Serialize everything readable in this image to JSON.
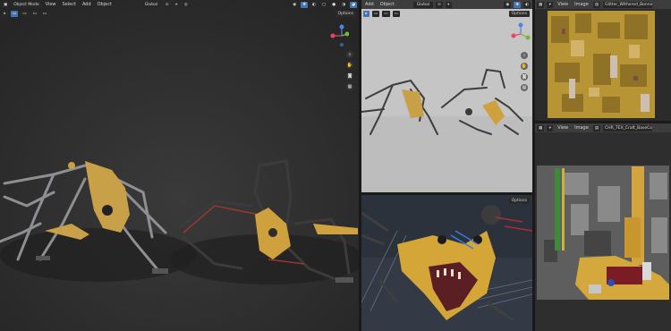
{
  "left_viewport": {
    "mode": "Object Mode",
    "menus": [
      "View",
      "Select",
      "Add",
      "Object"
    ],
    "transform": "Global",
    "options": "Options"
  },
  "mid_viewport": {
    "menus": [
      "Add",
      "Object"
    ],
    "transform": "Global",
    "options": "Options"
  },
  "mid_lower": {
    "options": "Options"
  },
  "top_image_editor": {
    "menus": [
      "View",
      "Image"
    ],
    "image_name": "Glitter_Withered_Bonnie_"
  },
  "bottom_image_editor": {
    "menus": [
      "View",
      "Image"
    ],
    "image_name": "CHR_TEX_Craft_BaseColor"
  },
  "icons": {
    "view": "view-icon",
    "zoom": "zoom-icon",
    "pan": "hand-icon",
    "camera": "camera-icon",
    "grid": "grid-icon"
  },
  "colors": {
    "header": "#3d3d3d",
    "axis_x": "#e8445c",
    "axis_y": "#6fb93d",
    "axis_z": "#4c86e0",
    "accent": "#4772b3",
    "texture_yellow": "#c9a13a"
  }
}
